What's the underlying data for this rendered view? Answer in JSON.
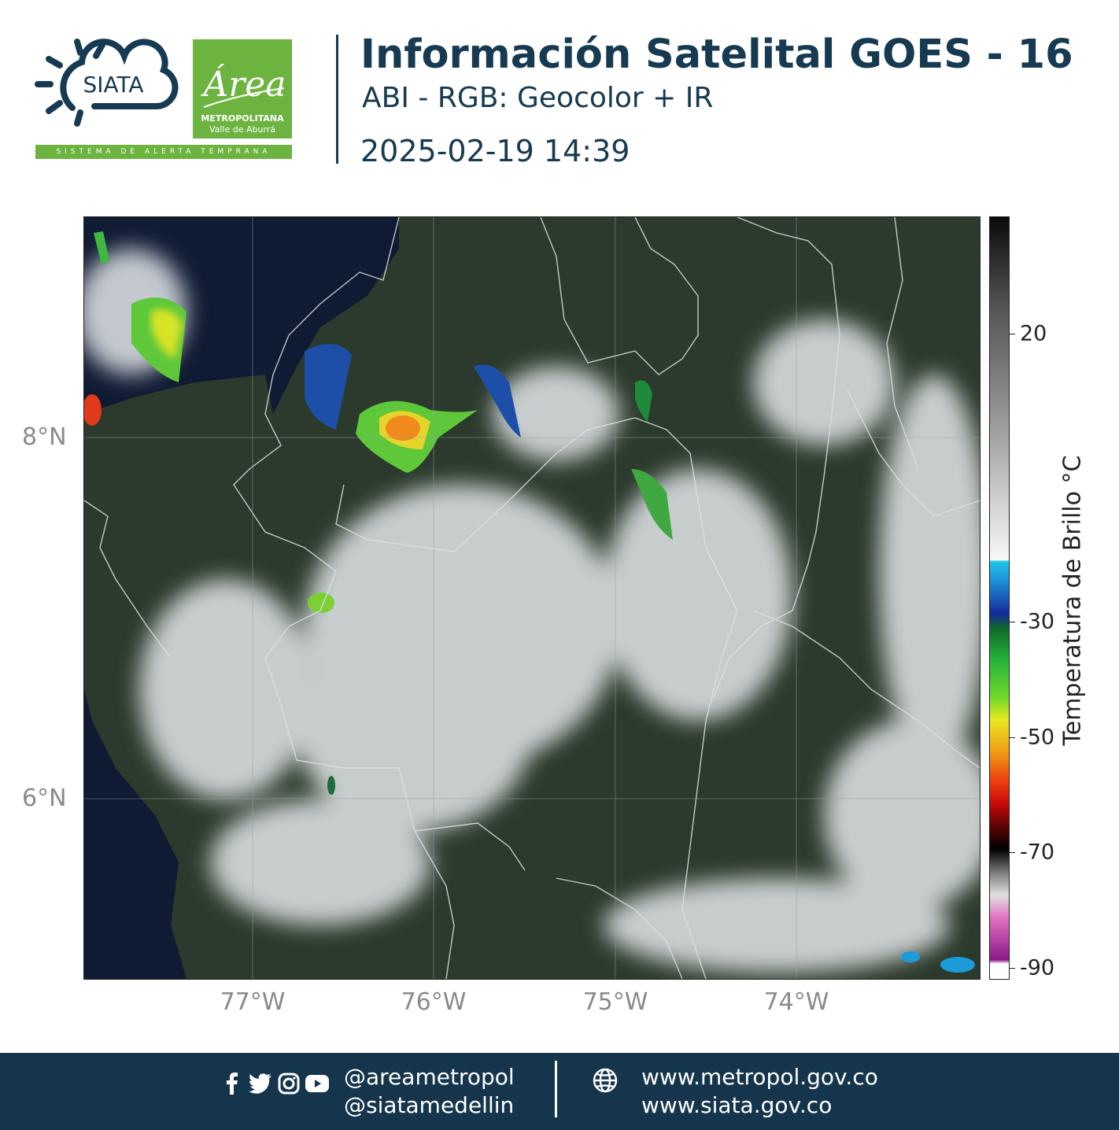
{
  "header": {
    "title": "Información Satelital GOES - 16",
    "subtitle": "ABI - RGB: Geocolor + IR",
    "timestamp": "2025-02-19 14:39",
    "siata_logo_text": "SIATA",
    "area_logo_word": "Área",
    "area_logo_line1": "METROPOLITANA",
    "area_logo_line2": "Valle de Aburrá",
    "alert_strip": "SISTEMA DE ALERTA TEMPRANA"
  },
  "map": {
    "lat_labels": [
      "8°N",
      "6°N"
    ],
    "lon_labels": [
      "77°W",
      "76°W",
      "75°W",
      "74°W"
    ],
    "ocean_color": "#0f1a33",
    "land_color": "#2a3a2a",
    "cloud_color": "#e8ecee"
  },
  "colorbar": {
    "title": "Temperatura de Brillo °C",
    "ticks": [
      "20",
      "-30",
      "-50",
      "-70",
      "-90"
    ]
  },
  "footer": {
    "social_icons": [
      "facebook-icon",
      "twitter-icon",
      "instagram-icon",
      "youtube-icon"
    ],
    "handle_1": "@areametropol",
    "handle_2": "@siatamedellin",
    "url_1": "www.metropol.gov.co",
    "url_2": "www.siata.gov.co",
    "background": "#15354d"
  }
}
